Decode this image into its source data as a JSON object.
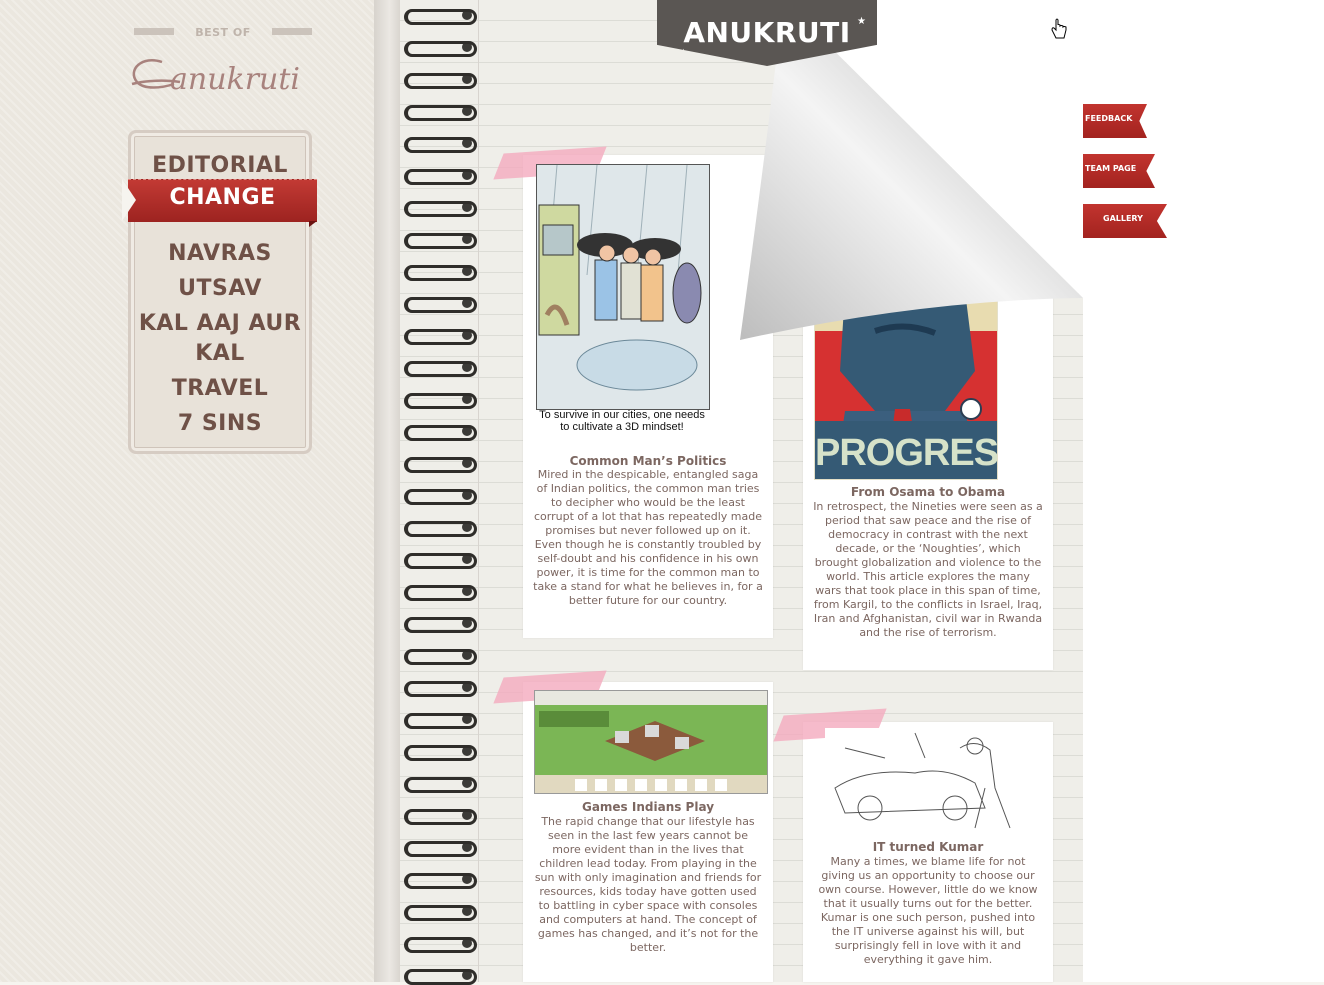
{
  "logo": {
    "best_of": "BEST OF",
    "script": "anukruti"
  },
  "menu": {
    "items": [
      {
        "label": "EDITORIAL"
      },
      {
        "label": "CHANGE",
        "active": true
      },
      {
        "label": "NAVRAS"
      },
      {
        "label": "UTSAV"
      },
      {
        "label": "KAL AAJ AUR KAL"
      },
      {
        "label": "TRAVEL"
      },
      {
        "label": "7 SINS"
      }
    ]
  },
  "header": {
    "title": "ANUKRUTI"
  },
  "articles": [
    {
      "title": "Common Man’s Politics",
      "caption": "To survive in our cities, one needs to cultivate a 3D mindset!",
      "desc": "Mired in the despicable, entangled saga of Indian politics, the common man tries to decipher who would be the least corrupt of a lot that has repeatedly made promises but never followed up on it. Even though he is constantly troubled by self-doubt and his confidence in his own power, it is time for the common man to take a stand for what he believes in, for a better future for our country."
    },
    {
      "title": "From Osama to Obama",
      "image_text": "PROGRESS",
      "desc": "In retrospect, the Nineties were seen as a period that saw peace and the rise of democracy in contrast with the next decade, or the ‘Noughties’, which brought globalization and violence to the world. This article explores the many wars that took place in this span of time, from Kargil, to the conflicts in Israel, Iraq, Iran and Afghanistan, civil war in Rwanda and the rise of terrorism."
    },
    {
      "title": "Games Indians Play",
      "desc": "The rapid change that our lifestyle has seen in the last few years cannot be more evident than in the lives that children lead today. From playing in the sun with only imagination and friends for resources, kids today have gotten used to battling in cyber space with consoles and computers at hand. The concept of games has changed, and it’s not for the better."
    },
    {
      "title": "IT turned Kumar",
      "desc": "Many a times, we blame life for not giving us an opportunity to choose our own course. However, little do we know that it usually turns out for the better. Kumar is one such person, pushed into the IT universe against his will, but surprisingly fell in love with it and everything it gave him."
    }
  ],
  "side_tabs": [
    {
      "label": "FEEDBACK"
    },
    {
      "label": "TEAM PAGE"
    },
    {
      "label": "GALLERY"
    }
  ],
  "colors": {
    "accent_red": "#b02a26",
    "menu_text": "#6f5147",
    "header_ribbon": "#5a5653",
    "tape_pink": "#f4aabe"
  }
}
